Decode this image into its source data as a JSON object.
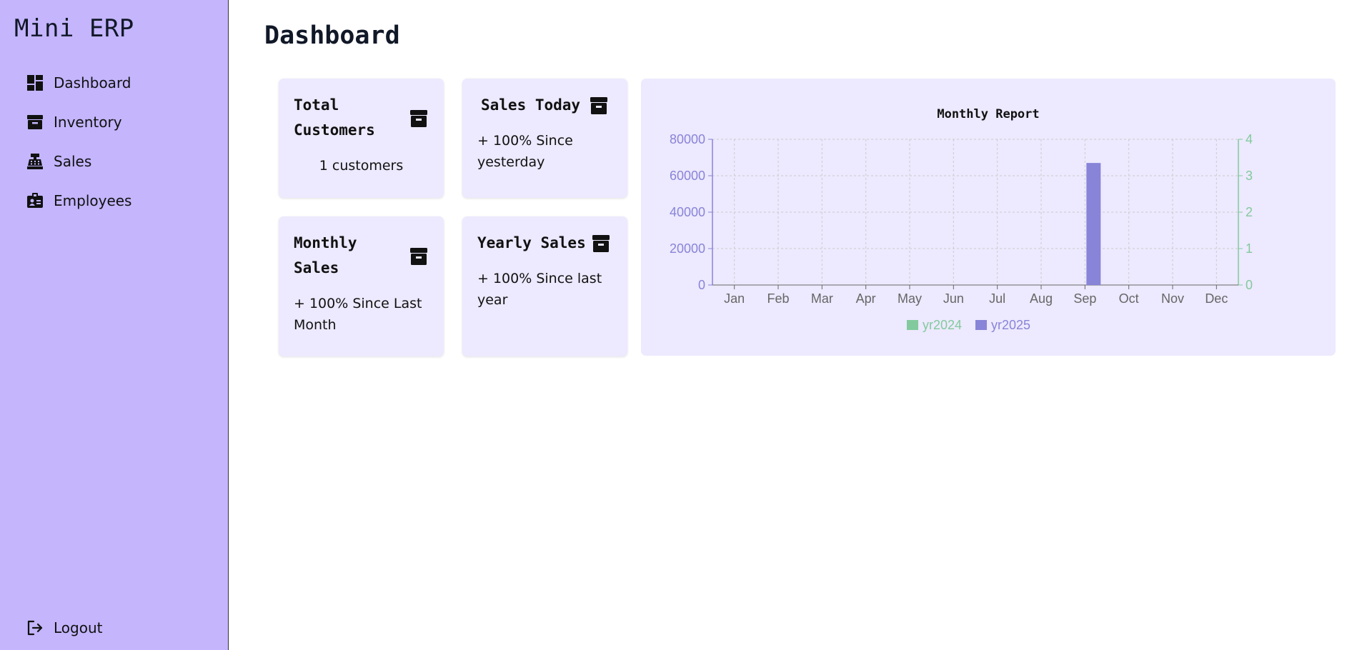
{
  "app": {
    "title": "Mini ERP"
  },
  "sidebar": {
    "items": [
      {
        "label": "Dashboard",
        "icon": "dashboard-icon"
      },
      {
        "label": "Inventory",
        "icon": "archive-box-icon"
      },
      {
        "label": "Sales",
        "icon": "cash-register-icon"
      },
      {
        "label": "Employees",
        "icon": "id-badge-icon"
      }
    ],
    "logout_label": "Logout"
  },
  "page": {
    "title": "Dashboard"
  },
  "cards": {
    "total_customers": {
      "title_line1": "Total",
      "title_line2": "Customers",
      "text": "1 customers",
      "icon": "archive-box-icon"
    },
    "sales_today": {
      "title": "Sales Today",
      "text_line1": "+ 100% Since",
      "text_line2": "yesterday",
      "icon": "archive-box-icon"
    },
    "monthly_sales": {
      "title_line1": "Monthly",
      "title_line2": "Sales",
      "text_line1": "+ 100% Since Last",
      "text_line2": "Month",
      "icon": "archive-box-icon"
    },
    "yearly_sales": {
      "title": "Yearly Sales",
      "text_line1": "+ 100% Since last",
      "text_line2": "year",
      "icon": "archive-box-icon"
    }
  },
  "colors": {
    "sidebar_bg": "#c4b5fd",
    "card_bg": "#ede9fe",
    "series_2024": "#82ca9d",
    "series_2025": "#8884d8"
  },
  "chart_data": {
    "type": "bar",
    "title": "Monthly Report",
    "categories": [
      "Jan",
      "Feb",
      "Mar",
      "Apr",
      "May",
      "Jun",
      "Jul",
      "Aug",
      "Sep",
      "Oct",
      "Nov",
      "Dec"
    ],
    "series": [
      {
        "name": "yr2024",
        "axis": "right",
        "color": "#82ca9d",
        "values": [
          0,
          0,
          0,
          0,
          0,
          0,
          0,
          0,
          0,
          0,
          0,
          0
        ]
      },
      {
        "name": "yr2025",
        "axis": "left",
        "color": "#8884d8",
        "values": [
          0,
          0,
          0,
          0,
          0,
          0,
          0,
          0,
          67000,
          0,
          0,
          0
        ]
      }
    ],
    "left_axis": {
      "ticks": [
        0,
        20000,
        40000,
        60000,
        80000
      ],
      "ylim": [
        0,
        80000
      ]
    },
    "right_axis": {
      "ticks": [
        0,
        1,
        2,
        3,
        4
      ],
      "ylim": [
        0,
        4
      ]
    },
    "grid": true,
    "legend": "bottom"
  }
}
